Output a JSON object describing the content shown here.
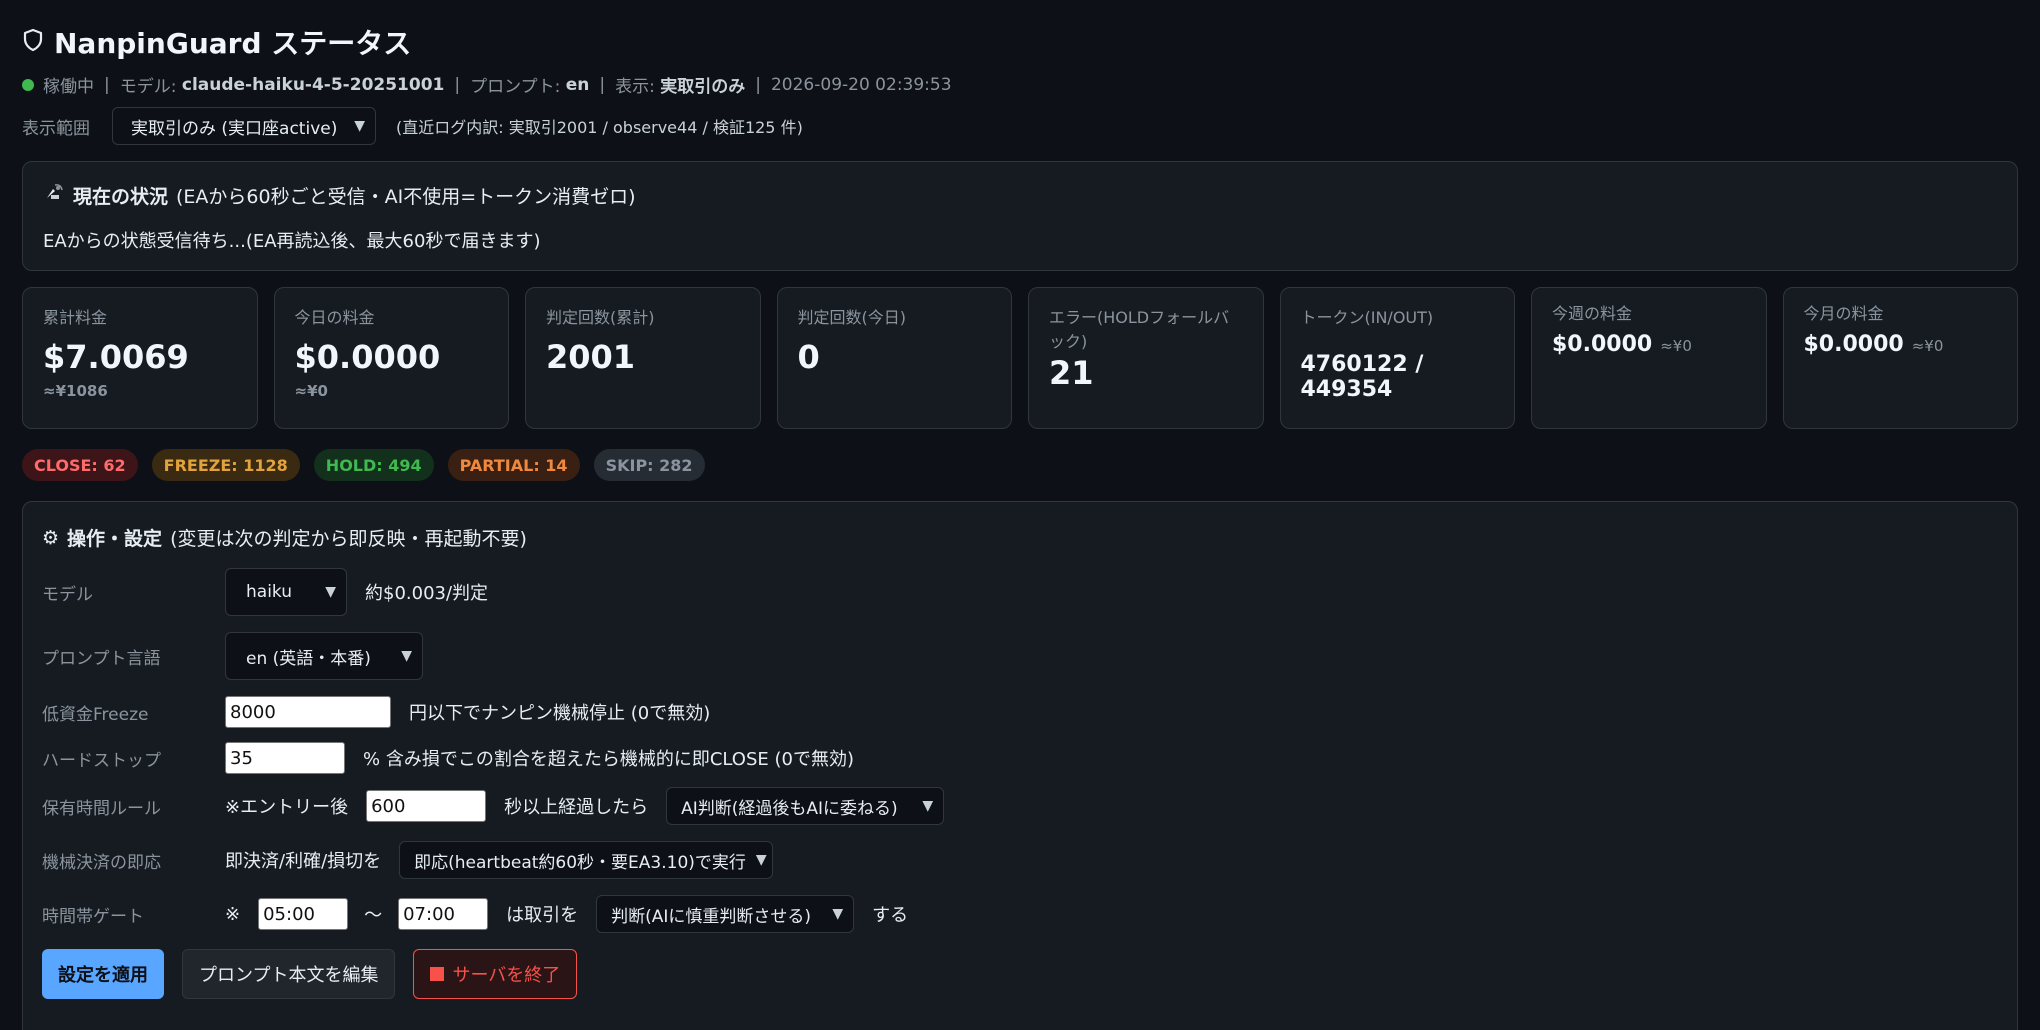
{
  "header": {
    "title": "NanpinGuard ステータス",
    "status": {
      "running": "稼働中",
      "model_label": "モデル:",
      "model_value": "claude-haiku-4-5-20251001",
      "prompt_label": "プロンプト:",
      "prompt_value": "en",
      "display_label": "表示:",
      "display_value": "実取引のみ",
      "timestamp": "2026-09-20 02:39:53"
    },
    "scope": {
      "label": "表示範囲",
      "selected": "実取引のみ (実口座active)",
      "note": "(直近ログ内訳: 実取引2001 / observe44 / 検証125 件)"
    }
  },
  "now_panel": {
    "title": "現在の状況",
    "subtitle": "(EAから60秒ごと受信・AI不使用=トークン消費ゼロ)",
    "body": "EAからの状態受信待ち...(EA再読込後、最大60秒で届きます)"
  },
  "cards": [
    {
      "label": "累計料金",
      "value": "$7.0069",
      "sub": "≈¥1086"
    },
    {
      "label": "今日の料金",
      "value": "$0.0000",
      "sub": "≈¥0"
    },
    {
      "label": "判定回数(累計)",
      "value": "2001"
    },
    {
      "label": "判定回数(今日)",
      "value": "0"
    },
    {
      "label": "エラー(HOLDフォールバック)",
      "value": "21"
    },
    {
      "label": "トークン(IN/OUT)",
      "value": "4760122 / 449354"
    },
    {
      "label": "今週の料金",
      "value": "$0.0000",
      "sub": "≈¥0"
    },
    {
      "label": "今月の料金",
      "value": "$0.0000",
      "sub": "≈¥0"
    }
  ],
  "badges": {
    "close": "CLOSE: 62",
    "freeze": "FREEZE: 1128",
    "hold": "HOLD: 494",
    "partial": "PARTIAL: 14",
    "skip": "SKIP: 282"
  },
  "settings": {
    "title": "操作・設定",
    "subtitle": "(変更は次の判定から即反映・再起動不要)",
    "model": {
      "label": "モデル",
      "selected": "haiku",
      "note": "約$0.003/判定"
    },
    "prompt_lang": {
      "label": "プロンプト言語",
      "selected": "en (英語・本番)"
    },
    "low_freeze": {
      "label": "低資金Freeze",
      "value": "8000",
      "note": "円以下でナンピン機械停止 (0で無効)"
    },
    "hard_stop": {
      "label": "ハードストップ",
      "value": "35",
      "note": "% 含み損でこの割合を超えたら機械的に即CLOSE (0で無効)"
    },
    "hold_time": {
      "label": "保有時間ルール",
      "prefix": "※エントリー後",
      "value": "600",
      "middle": "秒以上経過したら",
      "selected": "AI判断(経過後もAIに委ねる)"
    },
    "mech": {
      "label": "機械決済の即応",
      "prefix": "即決済/利確/損切を",
      "selected": "即応(heartbeat約60秒・要EA3.10)で実行"
    },
    "time_gate": {
      "label": "時間帯ゲート",
      "prefix": "※",
      "from": "05:00",
      "tilde": "〜",
      "to": "07:00",
      "middle": "は取引を",
      "selected": "判断(AIに慎重判断させる)",
      "suffix": "する"
    },
    "buttons": {
      "apply": "設定を適用",
      "edit_prompt": "プロンプト本文を編集",
      "shutdown": "サーバを終了"
    }
  },
  "colors": {
    "bg": "#0d1117",
    "panel": "#161b22",
    "accent": "#58a6ff",
    "ok": "#3fb950",
    "danger": "#f85149"
  }
}
